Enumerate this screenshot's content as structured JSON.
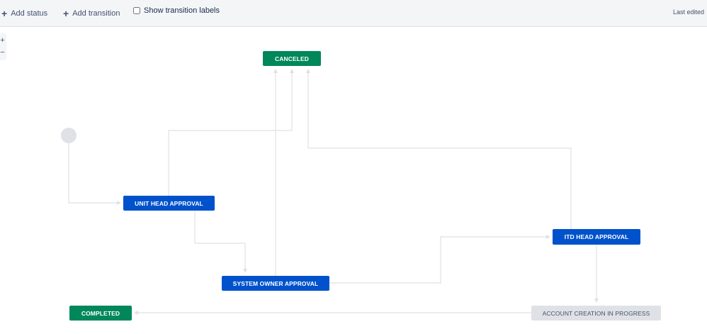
{
  "toolbar": {
    "add_status": "Add status",
    "add_transition": "Add transition",
    "show_labels": "Show transition labels",
    "last_edited": "Last edited"
  },
  "zoom": {
    "in": "+",
    "out": "−"
  },
  "statuses": {
    "canceled": "CANCELED",
    "unit_head": "UNIT HEAD APPROVAL",
    "system_owner": "SYSTEM OWNER APPROVAL",
    "itd_head": "ITD HEAD APPROVAL",
    "account_creation": "ACCOUNT CREATION IN PROGRESS",
    "completed": "COMPLETED"
  },
  "colors": {
    "done": "#00875a",
    "in_progress": "#0052cc",
    "todo": "#dfe1e6",
    "connector": "#dfe1e6"
  }
}
